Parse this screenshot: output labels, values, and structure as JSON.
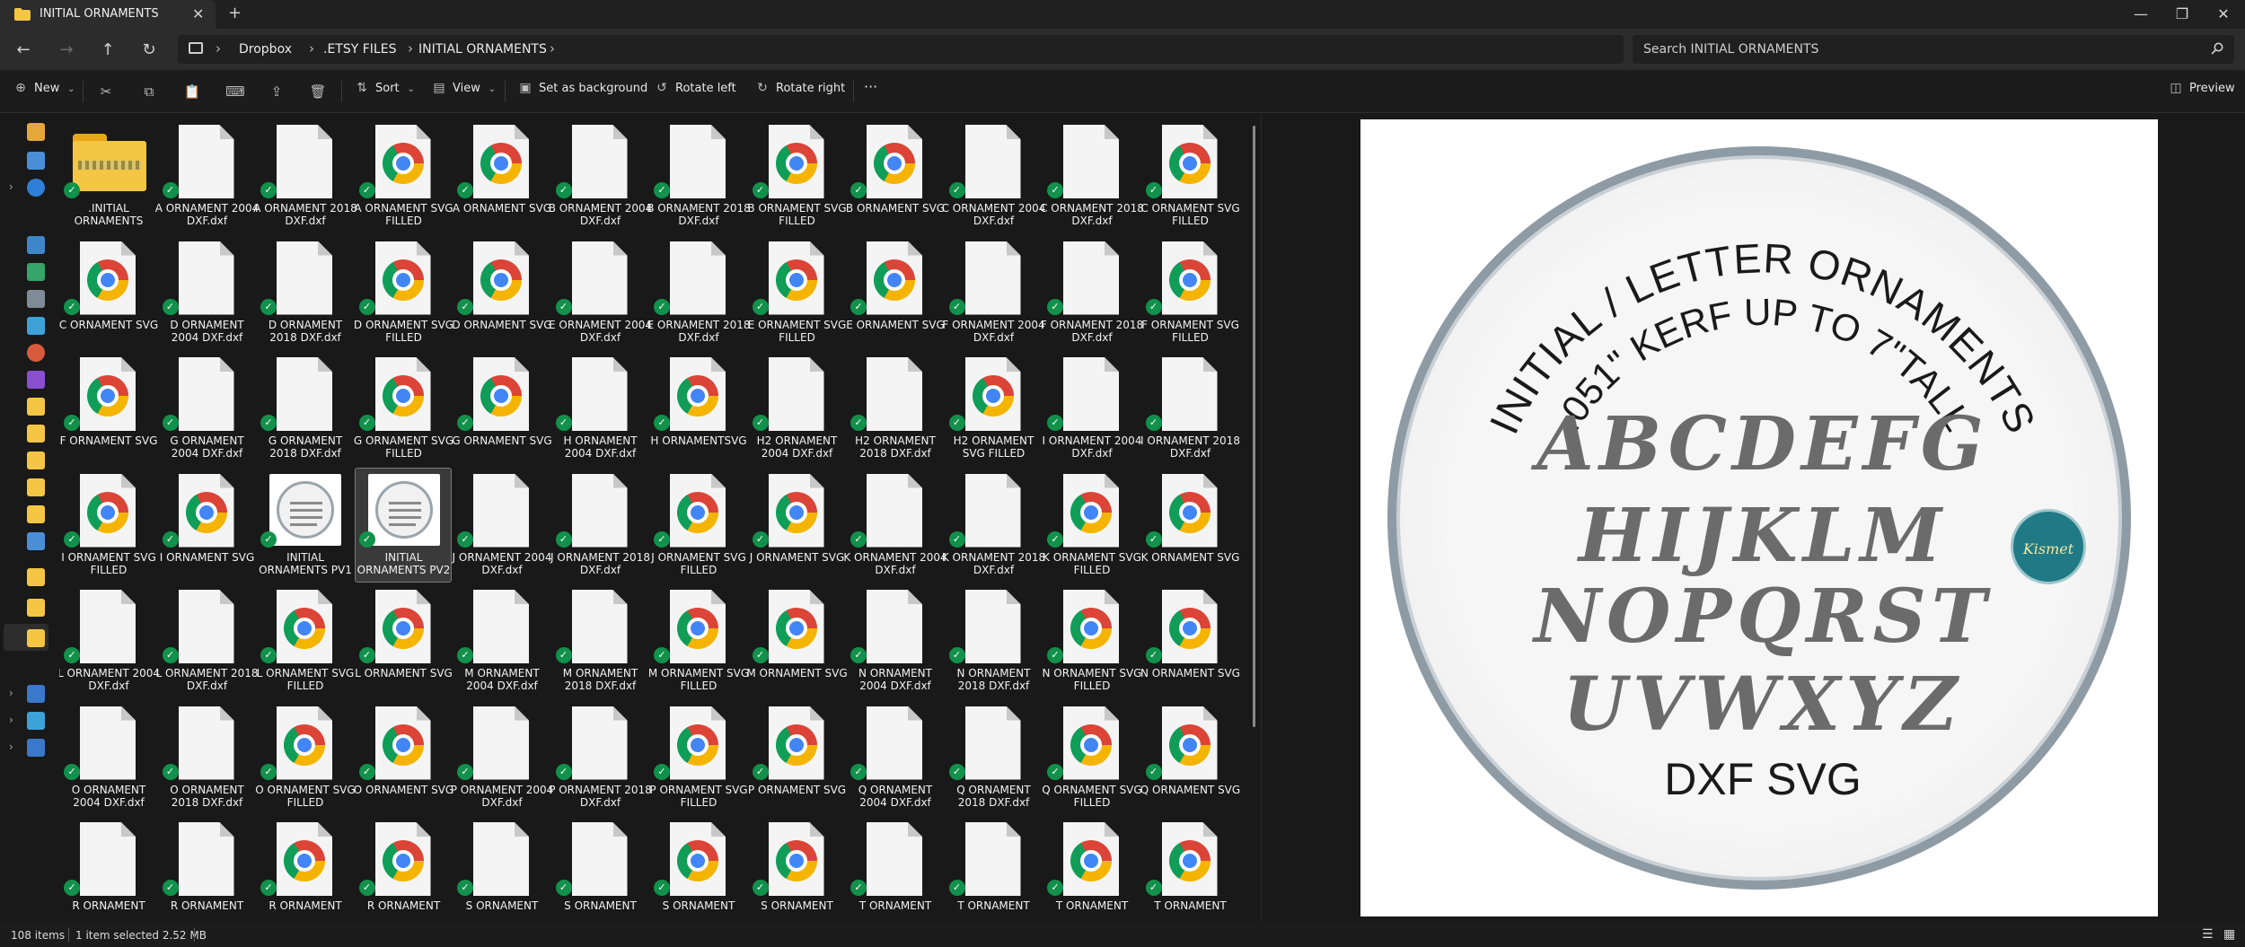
{
  "window": {
    "tab_title": "INITIAL ORNAMENTS",
    "new_tab": "+",
    "close_tab": "✕",
    "minimize": "—",
    "maximize": "❐",
    "close": "✕"
  },
  "address": {
    "crumbs": [
      "Dropbox",
      ".ETSY FILES",
      "INITIAL ORNAMENTS"
    ],
    "search_placeholder": "Search INITIAL ORNAMENTS"
  },
  "toolbar": {
    "new": "New",
    "sort": "Sort",
    "view": "View",
    "set_background": "Set as background",
    "rotate_left": "Rotate left",
    "rotate_right": "Rotate right",
    "more": "···",
    "preview": "Preview"
  },
  "files": [
    {
      "name": ".INITIAL ORNAMENTS",
      "type": "folder"
    },
    {
      "name": "A ORNAMENT 2004 DXF.dxf",
      "type": "dxf"
    },
    {
      "name": "A ORNAMENT 2018 DXF.dxf",
      "type": "dxf"
    },
    {
      "name": "A ORNAMENT SVG FILLED",
      "type": "svg"
    },
    {
      "name": "A ORNAMENT SVG",
      "type": "svg"
    },
    {
      "name": "B ORNAMENT 2004 DXF.dxf",
      "type": "dxf"
    },
    {
      "name": "B ORNAMENT 2018 DXF.dxf",
      "type": "dxf"
    },
    {
      "name": "B ORNAMENT SVG FILLED",
      "type": "svg"
    },
    {
      "name": "B ORNAMENT SVG",
      "type": "svg"
    },
    {
      "name": "C ORNAMENT 2004 DXF.dxf",
      "type": "dxf"
    },
    {
      "name": "C ORNAMENT 2018 DXF.dxf",
      "type": "dxf"
    },
    {
      "name": "C ORNAMENT SVG FILLED",
      "type": "svg"
    },
    {
      "name": "C ORNAMENT SVG",
      "type": "svg"
    },
    {
      "name": "D ORNAMENT 2004 DXF.dxf",
      "type": "dxf"
    },
    {
      "name": "D ORNAMENT 2018 DXF.dxf",
      "type": "dxf"
    },
    {
      "name": "D ORNAMENT SVG FILLED",
      "type": "svg"
    },
    {
      "name": "D ORNAMENT SVG",
      "type": "svg"
    },
    {
      "name": "E ORNAMENT 2004 DXF.dxf",
      "type": "dxf"
    },
    {
      "name": "E ORNAMENT 2018 DXF.dxf",
      "type": "dxf"
    },
    {
      "name": "E ORNAMENT SVG FILLED",
      "type": "svg"
    },
    {
      "name": "E ORNAMENT SVG",
      "type": "svg"
    },
    {
      "name": "F ORNAMENT 2004 DXF.dxf",
      "type": "dxf"
    },
    {
      "name": "F ORNAMENT 2018 DXF.dxf",
      "type": "dxf"
    },
    {
      "name": "F ORNAMENT SVG FILLED",
      "type": "svg"
    },
    {
      "name": "F ORNAMENT SVG",
      "type": "svg"
    },
    {
      "name": "G ORNAMENT 2004 DXF.dxf",
      "type": "dxf"
    },
    {
      "name": "G ORNAMENT 2018 DXF.dxf",
      "type": "dxf"
    },
    {
      "name": "G ORNAMENT SVG FILLED",
      "type": "svg"
    },
    {
      "name": "G ORNAMENT SVG",
      "type": "svg"
    },
    {
      "name": "H ORNAMENT 2004 DXF.dxf",
      "type": "dxf"
    },
    {
      "name": "H ORNAMENTSVG",
      "type": "svg"
    },
    {
      "name": "H2 ORNAMENT 2004 DXF.dxf",
      "type": "dxf"
    },
    {
      "name": "H2 ORNAMENT 2018 DXF.dxf",
      "type": "dxf"
    },
    {
      "name": "H2 ORNAMENT SVG FILLED",
      "type": "svg"
    },
    {
      "name": "I ORNAMENT 2004 DXF.dxf",
      "type": "dxf"
    },
    {
      "name": "I ORNAMENT 2018 DXF.dxf",
      "type": "dxf"
    },
    {
      "name": "I ORNAMENT SVG FILLED",
      "type": "svg"
    },
    {
      "name": "I ORNAMENT SVG",
      "type": "svg"
    },
    {
      "name": "INITIAL ORNAMENTS PV1",
      "type": "image"
    },
    {
      "name": "INITIAL ORNAMENTS PV2",
      "type": "image",
      "selected": true
    },
    {
      "name": "J ORNAMENT 2004 DXF.dxf",
      "type": "dxf"
    },
    {
      "name": "J ORNAMENT 2018 DXF.dxf",
      "type": "dxf"
    },
    {
      "name": "J ORNAMENT SVG FILLED",
      "type": "svg"
    },
    {
      "name": "J ORNAMENT SVG",
      "type": "svg"
    },
    {
      "name": "K ORNAMENT 2004 DXF.dxf",
      "type": "dxf"
    },
    {
      "name": "K ORNAMENT 2018 DXF.dxf",
      "type": "dxf"
    },
    {
      "name": "K ORNAMENT SVG FILLED",
      "type": "svg"
    },
    {
      "name": "K ORNAMENT SVG",
      "type": "svg"
    },
    {
      "name": "L ORNAMENT 2004 DXF.dxf",
      "type": "dxf"
    },
    {
      "name": "L ORNAMENT 2018 DXF.dxf",
      "type": "dxf"
    },
    {
      "name": "L ORNAMENT SVG FILLED",
      "type": "svg"
    },
    {
      "name": "L ORNAMENT SVG",
      "type": "svg"
    },
    {
      "name": "M ORNAMENT 2004 DXF.dxf",
      "type": "dxf"
    },
    {
      "name": "M ORNAMENT 2018 DXF.dxf",
      "type": "dxf"
    },
    {
      "name": "M ORNAMENT SVG FILLED",
      "type": "svg"
    },
    {
      "name": "M ORNAMENT SVG",
      "type": "svg"
    },
    {
      "name": "N ORNAMENT 2004 DXF.dxf",
      "type": "dxf"
    },
    {
      "name": "N ORNAMENT 2018 DXF.dxf",
      "type": "dxf"
    },
    {
      "name": "N ORNAMENT SVG FILLED",
      "type": "svg"
    },
    {
      "name": "N ORNAMENT SVG",
      "type": "svg"
    },
    {
      "name": "O ORNAMENT 2004 DXF.dxf",
      "type": "dxf"
    },
    {
      "name": "O ORNAMENT 2018 DXF.dxf",
      "type": "dxf"
    },
    {
      "name": "O ORNAMENT SVG FILLED",
      "type": "svg"
    },
    {
      "name": "O ORNAMENT SVG",
      "type": "svg"
    },
    {
      "name": "P ORNAMENT 2004 DXF.dxf",
      "type": "dxf"
    },
    {
      "name": "P ORNAMENT 2018 DXF.dxf",
      "type": "dxf"
    },
    {
      "name": "P ORNAMENT SVG FILLED",
      "type": "svg"
    },
    {
      "name": "P ORNAMENT SVG",
      "type": "svg"
    },
    {
      "name": "Q ORNAMENT 2004 DXF.dxf",
      "type": "dxf"
    },
    {
      "name": "Q ORNAMENT 2018 DXF.dxf",
      "type": "dxf"
    },
    {
      "name": "Q ORNAMENT SVG FILLED",
      "type": "svg"
    },
    {
      "name": "Q ORNAMENT SVG",
      "type": "svg"
    },
    {
      "name": "R ORNAMENT",
      "type": "dxf"
    },
    {
      "name": "R ORNAMENT",
      "type": "dxf"
    },
    {
      "name": "R ORNAMENT",
      "type": "svg"
    },
    {
      "name": "R ORNAMENT",
      "type": "svg"
    },
    {
      "name": "S ORNAMENT",
      "type": "dxf"
    },
    {
      "name": "S ORNAMENT",
      "type": "dxf"
    },
    {
      "name": "S ORNAMENT",
      "type": "svg"
    },
    {
      "name": "S ORNAMENT",
      "type": "svg"
    },
    {
      "name": "T ORNAMENT",
      "type": "dxf"
    },
    {
      "name": "T ORNAMENT",
      "type": "dxf"
    },
    {
      "name": "T ORNAMENT",
      "type": "svg"
    },
    {
      "name": "T ORNAMENT",
      "type": "svg"
    }
  ],
  "preview": {
    "arc_top": "INITIAL / LETTER ORNAMENTS",
    "arc_sub": ".051\" KERF UP TO 7\"TALL",
    "line1": "ABCDEFG",
    "line2": "HIJKLM",
    "line3": "NOPQRST",
    "line4": "UVWXYZ",
    "footer": "DXF SVG",
    "logo": "Kismet"
  },
  "status": {
    "count": "108 items",
    "selection": "1 item selected  2.52 MB"
  },
  "colors": {
    "sync_badge": "#11914b",
    "folder": "#f5c643"
  }
}
